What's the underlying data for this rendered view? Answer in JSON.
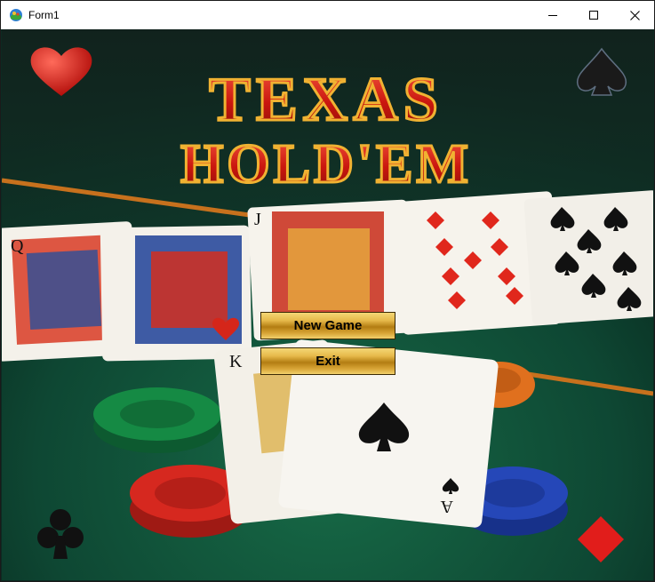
{
  "window": {
    "title": "Form1"
  },
  "title_controls": {
    "minimize": "minimize-icon",
    "maximize": "maximize-icon",
    "close": "close-icon"
  },
  "logo": {
    "line1": "TEXAS",
    "line2": "HOLD'EM"
  },
  "buttons": {
    "new_game": "New Game",
    "exit": "Exit"
  },
  "colors": {
    "felt": "#0d3b2c",
    "logo_red": "#d8241c",
    "logo_gold": "#f0b232",
    "button_gold": "#d9a637"
  }
}
